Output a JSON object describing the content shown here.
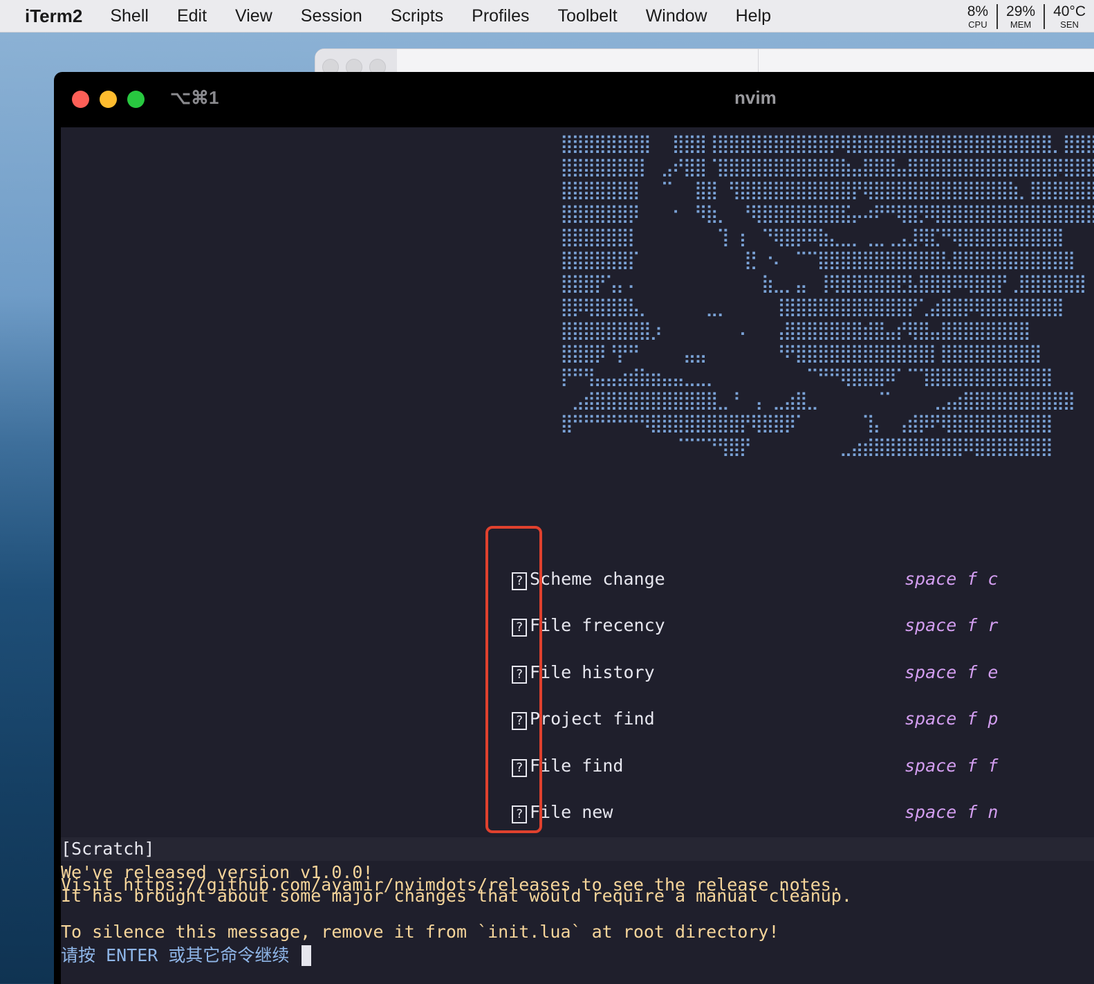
{
  "menubar": {
    "app_name": "iTerm2",
    "items": [
      "Shell",
      "Edit",
      "View",
      "Session",
      "Scripts",
      "Profiles",
      "Toolbelt",
      "Window",
      "Help"
    ],
    "stats": [
      {
        "value": "8%",
        "label": "CPU"
      },
      {
        "value": "29%",
        "label": "MEM"
      },
      {
        "value": "40°C",
        "label": "SEN"
      }
    ]
  },
  "window": {
    "tab_shortcut": "⌥⌘1",
    "title": "nvim"
  },
  "dashboard": {
    "header_art": [
      "⣿⣿⣿⣿⣿⣿⣿⣿⠀⠀⣿⣿⣿⢸⣿⣿⣿⣿⣿⣿⣿⣿⣿⣿⡿⢿⣿⣿⣿⣿⣿⣿⣿⣿⣿⣿⣿⣿⣿⣿⣿⣿⣿⣿⡀⣿⣿⣿⣿⣿⣿",
      "⣿⣿⣿⣿⣿⣿⣿⡇⠀⣠⠞⣿⣿⠈⣿⣿⣿⣿⣿⣿⣿⣿⣿⣿⣿⣷⣤⣿⣿⣿⣤⣿⣿⣿⣿⣿⣿⣿⣿⣿⣿⣿⣿⣿⡿⣿⣿⣿⣿⣿⣿",
      "⣿⣿⣿⣿⣿⣿⣿⠀⠀⠉⠀⠀⣿⣿⠀⢻⣿⣿⣿⣿⣿⣿⣿⣿⣿⣿⡟⢿⣿⣿⣿⣿⣿⣿⣿⣿⣿⣿⣿⣿⣷⡀⣿⣿⣿⣿⣿⣿⣿",
      "⣿⣿⣿⣿⣿⣿⡿⠀⠀⠀⠂⠀⠻⣷⡀⠀⠘⢿⣿⣿⣿⣿⣿⣿⣿⣯⡤⠴⠟⠛⢿⣿⡻⢿⣿⣿⣿⣿⣿⣿⣿⣿⣿⣿⣿⣿⣿⣿",
      "⣿⣿⣿⣿⣿⣿⡇⠀⠀⠀⠀⠀⠀⠀⢹⠀⡆⠀⠙⢿⣿⡿⠿⣷⣄⣀⡀⢀⣀⢀⣠⣸⢿⣏⠛⢿⣿⣿⣿⣿⣿⣿⣿⣿⣿",
      "⣿⣿⣿⣿⣿⣿⡏⠀⠀⠀⠀⠀⠀⠀⠀⠀⢸⡃⠐⠄⠀⠉⠉⣿⣿⣿⣿⣿⣿⣿⣿⣿⣿⣿⣧⣿⣿⣿⣿⣿⣿⣿⣿⣿⣿⣿",
      "⣿⣿⣿⡟⢡⡄⠄⠀⠀⠀⠀⠀⠀⠀⠀⠀⠀⠀⣷⣀⡀⣤⠀⢸⢿⣿⣿⣿⣿⣿⣟⣧⣿⣿⣿⠿⢿⣿⣿⡟⢀⣿⣿⣿⣿⣿⣿",
      "⣿⡿⢿⣿⣿⣿⣧⡀⠀⠀⠀⠀⠀⣀⡀⠀⠀⠀⠀⢸⣿⣿⣿⣿⣿⣿⣿⣿⣿⣿⣿⡟⢁⣴⣿⣿⡿⢿⣿⣿⣿⣿⣿⣿⣿",
      "⣿⣿⣿⣿⣿⣿⣿⣿⡰⠀⠀⠀⠀⠀⠀⠀⠄⠀⠀⢠⣿⣿⣿⣿⣿⣿⣿⣾⣿⣤⡞⢿⣿⣤⣿⣿⣿⣿⣿⣿⣿⣿",
      "⣿⣿⣿⡿⠘⡟⠛⠀⠀⠀⠀⣤⣤⠀⠀⠀⠀⠀⠀⠘⠟⣿⣿⣿⣿⣿⣿⣿⣿⣿⣿⣿⣿⡇⣿⣿⣿⣿⣿⣿⣿⣿⣿",
      "⡟⠛⢻⣤⣤⣴⣾⣷⣶⣤⣤⣀⣀⡀⠀⠀⠀⠀⠀⠀⠀⠀⠉⠛⠛⢿⣿⣿⣿⠿⠁⠉⢹⣿⣿⣿⣿⣿⣿⣿⣿⣿⣿⣿",
      "⠀⣠⣾⣿⣿⣿⣿⣿⣿⣿⣿⣿⣿⣿⣀⠘⠀⢠⠀⣀⣴⣿⣀⠀⠀⠀⠀⠀⠈⠁⠀⠀⠀⢀⣠⣴⣿⣿⣿⣿⣿⣿⣿⣿⣿⣿",
      "⣿⠛⠛⠛⠛⠛⠛⠻⣿⣿⣿⣿⣿⣿⣿⣿⡟⢿⣿⣿⡿⠁⠀⠀⠀⠀⠀⢹⡄⠀⢠⣾⡿⠟⢿⣿⣿⣿⣿⣿⣿⣿⣿⣿",
      "⠀⠀⠀⠀⠀⠀⠀⠀⠀⠀⠈⠉⠉⠙⢻⣿⡟⠀⠀⠀⠀⠀⠀⠀⠀⣀⣴⣾⣿⣿⣿⣿⣿⣿⣿⣿⠿⣿⣿⣿⣿⣿⣿⣿"
    ],
    "entries": [
      {
        "icon": "?",
        "label": "Scheme change",
        "key": "space f c"
      },
      {
        "icon": "?",
        "label": "File frecency",
        "key": "space f r"
      },
      {
        "icon": "?",
        "label": "File history",
        "key": "space f e"
      },
      {
        "icon": "?",
        "label": "Project find",
        "key": "space f p"
      },
      {
        "icon": "?",
        "label": "File find",
        "key": "space f f"
      },
      {
        "icon": "?",
        "label": "File new",
        "key": "space f n"
      }
    ]
  },
  "statusline": {
    "buffer_name": "[Scratch]"
  },
  "messages": [
    "We've released version v1.0.0!",
    "It has brought about some major changes that would require a manual cleanup.",
    "",
    "Visit https://github.com/ayamir/nvimdots/releases to see the release notes.",
    "",
    "To silence this message, remove it from `init.lua` at root directory!"
  ],
  "prompt": "请按 ENTER 或其它命令继续",
  "colors": {
    "terminal_bg": "#1f1f2c",
    "art": "#7aa2d6",
    "keys": "#d39ef0",
    "message": "#f6d59a",
    "highlight_box": "#e0412e"
  }
}
